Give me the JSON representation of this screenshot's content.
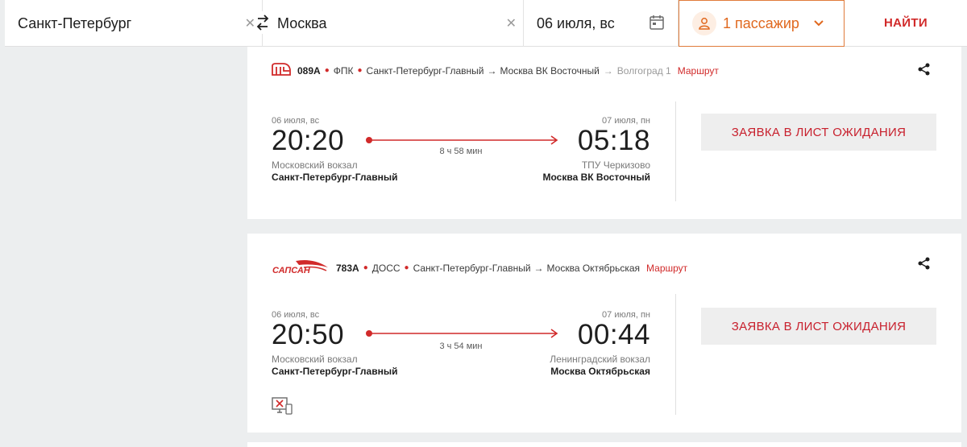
{
  "search": {
    "from": "Санкт-Петербург",
    "to": "Москва",
    "date": "06 июля, вс",
    "passengers": "1 пассажир",
    "find": "НАЙТИ"
  },
  "trains": [
    {
      "number": "089А",
      "carrier": "ФПК",
      "route_from": "Санкт-Петербург-Главный",
      "route_to": "Москва ВК Восточный",
      "route_via": "Волгоград 1",
      "route_link": "Маршрут",
      "dep_date": "06 июля, вс",
      "dep_time": "20:20",
      "dep_station_sub": "Московский вокзал",
      "dep_station": "Санкт-Петербург-Главный",
      "duration": "8 ч 58 мин",
      "arr_date": "07 июля, пн",
      "arr_time": "05:18",
      "arr_station_sub": "ТПУ Черкизово",
      "arr_station": "Москва ВК Восточный",
      "action": "ЗАЯВКА В ЛИСТ ОЖИДАНИЯ"
    },
    {
      "number": "783А",
      "brand": "САПСАН",
      "carrier": "ДОСС",
      "route_from": "Санкт-Петербург-Главный",
      "route_to": "Москва Октябрьская",
      "route_link": "Маршрут",
      "dep_date": "06 июля, вс",
      "dep_time": "20:50",
      "dep_station_sub": "Московский вокзал",
      "dep_station": "Санкт-Петербург-Главный",
      "duration": "3 ч 54 мин",
      "arr_date": "07 июля, пн",
      "arr_time": "00:44",
      "arr_station_sub": "Ленинградский вокзал",
      "arr_station": "Москва Октябрьская",
      "action": "ЗАЯВКА В ЛИСТ ОЖИДАНИЯ"
    }
  ],
  "colors": {
    "accent_red": "#d12a2a",
    "passenger_orange": "#e0681e"
  }
}
